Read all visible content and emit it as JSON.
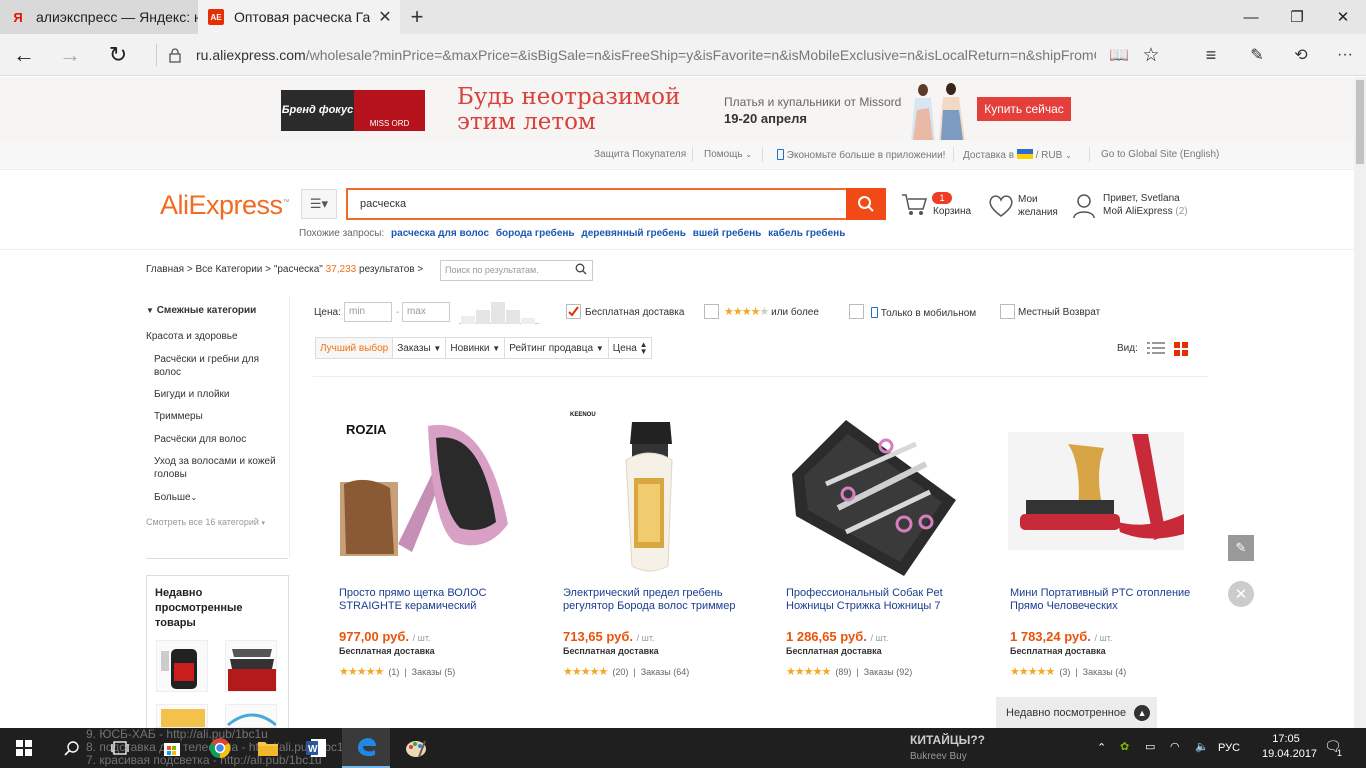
{
  "browser": {
    "tabs": [
      {
        "title": "алиэкспресс — Яндекс: наш",
        "icon": "Я",
        "active": false
      },
      {
        "title": "Оптовая расческа Гале",
        "icon": "AE",
        "active": true
      }
    ],
    "new_tab": "+",
    "window_controls": {
      "minimize": "—",
      "maximize": "❐",
      "close": "✕"
    },
    "url_host": "ru.aliexpress.com",
    "url_path": "/wholesale?minPrice=&maxPrice=&isBigSale=n&isFreeShip=y&isFavorite=n&isMobileExclusive=n&isLocalReturn=n&shipFromCountry=&"
  },
  "banner": {
    "brand_left": "Бренд фокус",
    "brand_right": "MISS ORD",
    "headline_1": "Будь неотразимой",
    "headline_2": "этим летом",
    "subtitle": "Платья и купальники от Missord",
    "dates": "19-20 апреля",
    "cta": "Купить сейчас"
  },
  "topnav": {
    "buyer_protection": "Защита Покупателя",
    "help": "Помощь",
    "app": "Экономьте больше в приложении!",
    "delivery": "Доставка в",
    "currency": "RUB",
    "global": "Go to Global Site (English)"
  },
  "header": {
    "logo_main": "AliExpress",
    "search_value": "расческа",
    "related_label": "Похожие запросы:",
    "related": [
      "расческа для волос",
      "борода гребень",
      "деревянный гребень",
      "вшей гребень",
      "кабель гребень"
    ],
    "cart_count": "1",
    "cart_label": "Корзина",
    "wish_1": "Мои",
    "wish_2": "желания",
    "user_1": "Привет, Svetlana",
    "user_2": "Мой AliExpress",
    "user_count": "(2)"
  },
  "breadcrumb": {
    "home": "Главная",
    "all": "Все Категории",
    "query": "\"расческа\"",
    "count": "37,233",
    "results": "результатов",
    "search_placeholder": "Поиск по результатам."
  },
  "sidebar": {
    "heading": "Смежные категории",
    "category": "Красота и здоровье",
    "items": [
      "Расчёски и гребни для волос",
      "Бигуди и плойки",
      "Триммеры",
      "Расчёски для волос",
      "Уход за волосами и кожей головы"
    ],
    "more": "Больше",
    "see_all": "Смотреть все 16 категорий",
    "recent_title": "Недавно просмотренные товары"
  },
  "filters": {
    "price_label": "Цена:",
    "min_placeholder": "min",
    "max_placeholder": "max",
    "free_shipping": "Бесплатная доставка",
    "free_shipping_checked": true,
    "rating_suffix": "или более",
    "mobile_only": "Только в мобильном",
    "local_return": "Местный Возврат",
    "sort": [
      "Лучший выбор",
      "Заказы",
      "Новинки",
      "Рейтинг продавца",
      "Цена"
    ],
    "view_label": "Вид:"
  },
  "products": [
    {
      "title": "Просто прямо щетка ВОЛОС STRAIGHTE керамический",
      "price": "977,00 руб.",
      "unit": "/ шт.",
      "shipping": "Бесплатная доставка",
      "reviews": "(1)",
      "orders": "Заказы (5)",
      "brand": "ROZIA"
    },
    {
      "title": "Электрический предел гребень регулятор Борода волос триммер",
      "price": "713,65 руб.",
      "unit": "/ шт.",
      "shipping": "Бесплатная доставка",
      "reviews": "(20)",
      "orders": "Заказы (64)",
      "brand": "KEENOU"
    },
    {
      "title": "Профессиональный Собак Pet Ножницы Стрижка Ножницы 7",
      "price": "1 286,65 руб.",
      "unit": "/ шт.",
      "shipping": "Бесплатная доставка",
      "reviews": "(89)",
      "orders": "Заказы (92)"
    },
    {
      "title": "Мини Портативный PTC отопление Прямо Человеческих",
      "price": "1 783,24 руб.",
      "unit": "/ шт.",
      "shipping": "Бесплатная доставка",
      "reviews": "(3)",
      "orders": "Заказы (4)"
    }
  ],
  "recent_panel": "Недавно посмотренное",
  "background_text": {
    "line1": "9. ЮСБ-ХАБ - http://ali.pub/1bc1u",
    "line2": "8. подставка для телефона - http://ali.pub/1bc1u",
    "line3": "7. красивая подсветка - http://ali.pub/1bc1u",
    "ad_title": "КИТАЙЦЫ??",
    "ad_channel": "Bukreev Buy"
  },
  "taskbar": {
    "lang": "РУС",
    "time": "17:05",
    "date": "19.04.2017",
    "notifications": "1"
  }
}
